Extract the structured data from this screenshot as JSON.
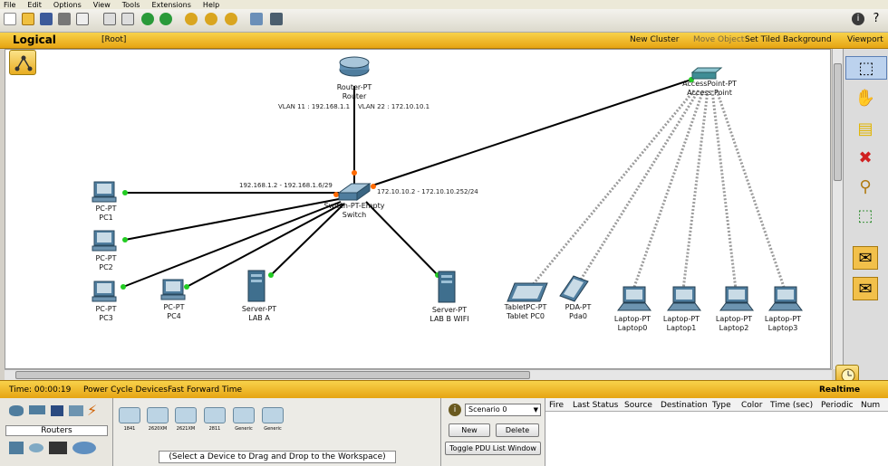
{
  "menu": [
    "File",
    "Edit",
    "Options",
    "View",
    "Tools",
    "Extensions",
    "Help"
  ],
  "topbar": {
    "mode": "Logical",
    "root": "[Root]",
    "new_cluster": "New Cluster",
    "move_object": "Move Object",
    "set_tiled_background": "Set Tiled Background",
    "viewport": "Viewport"
  },
  "bottombar": {
    "time": "Time: 00:00:19",
    "power_cycle": "Power Cycle Devices",
    "fast_forward": "Fast Forward Time",
    "realtime": "Realtime"
  },
  "devices_panel": {
    "category": "Routers",
    "models": [
      "1841",
      "2620XM",
      "2621XM",
      "2811",
      "Generic",
      "Generic"
    ],
    "hint": "(Select a Device to Drag and Drop to the Workspace)"
  },
  "scenario": {
    "selected": "Scenario 0",
    "new_label": "New",
    "delete_label": "Delete",
    "toggle_label": "Toggle PDU List Window"
  },
  "pdu_columns": [
    "Fire",
    "Last Status",
    "Source",
    "Destination",
    "Type",
    "Color",
    "Time (sec)",
    "Periodic",
    "Num"
  ],
  "topology": {
    "router": {
      "type": "Router-PT",
      "name": "Router"
    },
    "switch": {
      "type": "Switch-PT-Empty",
      "name": "Switch"
    },
    "access_point": {
      "type": "AccessPoint-PT",
      "name": "Access Point"
    },
    "pcs": [
      {
        "type": "PC-PT",
        "name": "PC1"
      },
      {
        "type": "PC-PT",
        "name": "PC2"
      },
      {
        "type": "PC-PT",
        "name": "PC3"
      },
      {
        "type": "PC-PT",
        "name": "PC4"
      }
    ],
    "servers": [
      {
        "type": "Server-PT",
        "name": "LAB A"
      },
      {
        "type": "Server-PT",
        "name": "LAB B WIFI"
      }
    ],
    "wireless": [
      {
        "type": "TabletPC-PT",
        "name": "Tablet PC0"
      },
      {
        "type": "PDA-PT",
        "name": "Pda0"
      },
      {
        "type": "Laptop-PT",
        "name": "Laptop0"
      },
      {
        "type": "Laptop-PT",
        "name": "Laptop1"
      },
      {
        "type": "Laptop-PT",
        "name": "Laptop2"
      },
      {
        "type": "Laptop-PT",
        "name": "Laptop3"
      }
    ],
    "vlan11": "VLAN 11 : 192.168.1.1",
    "vlan22": "VLAN 22 : 172.10.10.1",
    "range_a": "192.168.1.2 - 192.168.1.6/29",
    "range_b": "172.10.10.2 - 172.10.10.252/24"
  },
  "colors": {
    "accent": "#e6a412",
    "link": "#000000",
    "port_up": "#22cc22",
    "port_orange": "#ff6a00"
  }
}
